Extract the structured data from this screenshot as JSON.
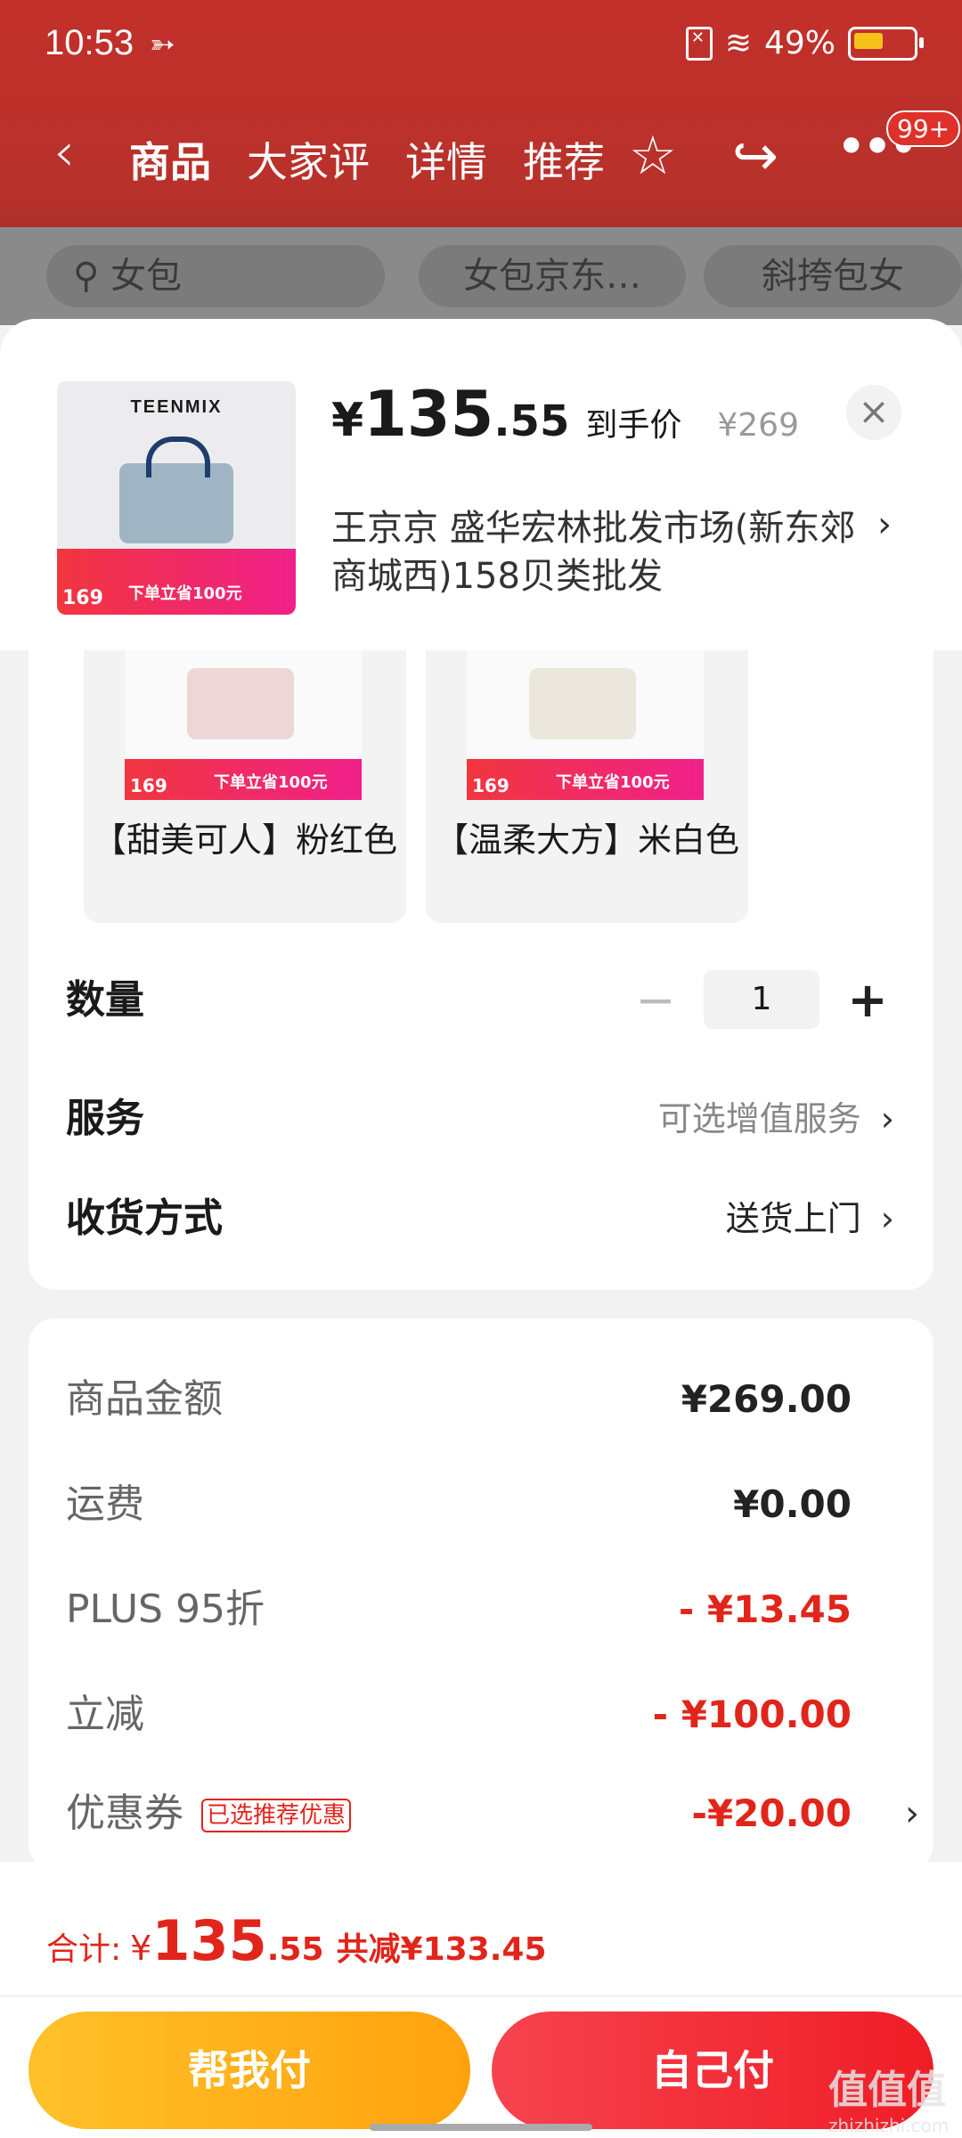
{
  "status": {
    "time": "10:53",
    "battery": "49%"
  },
  "nav": {
    "tabs": [
      "商品",
      "大家评",
      "详情",
      "推荐"
    ],
    "badge": "99+"
  },
  "bg_search": {
    "query": "女包",
    "chip1": "女包京东…",
    "chip2": "斜挎包女"
  },
  "product": {
    "brand": "TEENMIX",
    "thumb_price": "169",
    "thumb_promo": "下单立省100元",
    "price_yen": "¥",
    "price_int": "135",
    "price_dec": ".55",
    "price_tag": "到手价",
    "orig_price": "¥269",
    "address": "王京京  盛华宏林批发市场(新东郊商城西)158贝类批发"
  },
  "colors": [
    {
      "label": "【甜美可人】粉红色",
      "promo_price": "169",
      "promo": "下单立省100元",
      "color": "#ecd6d6"
    },
    {
      "label": "【温柔大方】米白色",
      "promo_price": "169",
      "promo": "下单立省100元",
      "color": "#ece7dc"
    }
  ],
  "options": {
    "qty_label": "数量",
    "qty_value": "1",
    "service_label": "服务",
    "service_value": "可选增值服务",
    "delivery_label": "收货方式",
    "delivery_value": "送货上门"
  },
  "fees": [
    {
      "k": "商品金额",
      "v": "¥269.00"
    },
    {
      "k": "运费",
      "v": "¥0.00"
    },
    {
      "k": "PLUS 95折",
      "v": "- ¥13.45"
    },
    {
      "k": "立减",
      "v": "- ¥100.00"
    },
    {
      "k": "优惠券",
      "tag": "已选推荐优惠",
      "v": "-¥20.00"
    }
  ],
  "footer": {
    "total_label": "合计:",
    "total_yen": "¥",
    "total_int": "135",
    "total_dec": ".55",
    "total_save": "共减¥133.45",
    "btn_help": "帮我付",
    "btn_self": "自己付",
    "watermark": "值值值",
    "watermark_sub": "zhizhizhi.com"
  },
  "colors_theme": {
    "accent_red": "#e1251b",
    "header_red": "#c3302a",
    "btn_yellow": "#ffb01b"
  }
}
